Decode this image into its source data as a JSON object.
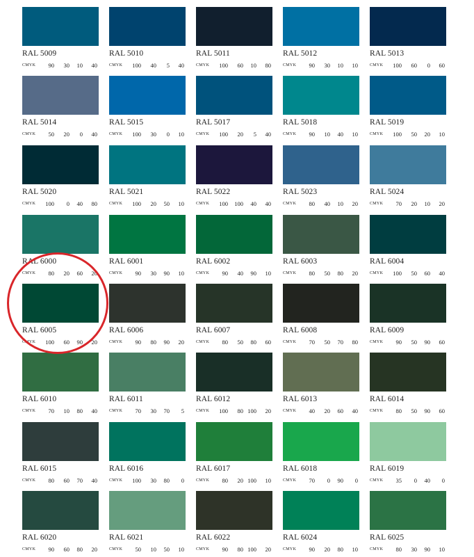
{
  "cmyk_label": "CMYK",
  "highlight_color": "#d9262a",
  "highlighted": "RAL 6005",
  "rows": [
    [
      {
        "name": "RAL 5009",
        "hex": "#005B7D",
        "c": "90",
        "m": "30",
        "y": "10",
        "k": "40"
      },
      {
        "name": "RAL 5010",
        "hex": "#00436E",
        "c": "100",
        "m": "40",
        "y": "5",
        "k": "40"
      },
      {
        "name": "RAL 5011",
        "hex": "#111F2E",
        "c": "100",
        "m": "60",
        "y": "10",
        "k": "80"
      },
      {
        "name": "RAL 5012",
        "hex": "#0070A3",
        "c": "90",
        "m": "30",
        "y": "10",
        "k": "10"
      },
      {
        "name": "RAL 5013",
        "hex": "#03294E",
        "c": "100",
        "m": "60",
        "y": "0",
        "k": "60"
      }
    ],
    [
      {
        "name": "RAL 5014",
        "hex": "#566B88",
        "c": "50",
        "m": "20",
        "y": "0",
        "k": "40"
      },
      {
        "name": "RAL 5015",
        "hex": "#0067AA",
        "c": "100",
        "m": "30",
        "y": "0",
        "k": "10"
      },
      {
        "name": "RAL 5017",
        "hex": "#00527C",
        "c": "100",
        "m": "20",
        "y": "5",
        "k": "40"
      },
      {
        "name": "RAL 5018",
        "hex": "#00878D",
        "c": "90",
        "m": "10",
        "y": "40",
        "k": "10"
      },
      {
        "name": "RAL 5019",
        "hex": "#005A88",
        "c": "100",
        "m": "50",
        "y": "20",
        "k": "10"
      }
    ],
    [
      {
        "name": "RAL 5020",
        "hex": "#002B35",
        "c": "100",
        "m": "0",
        "y": "40",
        "k": "80"
      },
      {
        "name": "RAL 5021",
        "hex": "#007480",
        "c": "100",
        "m": "20",
        "y": "50",
        "k": "10"
      },
      {
        "name": "RAL 5022",
        "hex": "#1C173C",
        "c": "100",
        "m": "100",
        "y": "40",
        "k": "40"
      },
      {
        "name": "RAL 5023",
        "hex": "#2F628C",
        "c": "80",
        "m": "40",
        "y": "10",
        "k": "20"
      },
      {
        "name": "RAL 5024",
        "hex": "#3F7B9C",
        "c": "70",
        "m": "20",
        "y": "10",
        "k": "20"
      }
    ],
    [
      {
        "name": "RAL 6000",
        "hex": "#1A7566",
        "c": "80",
        "m": "20",
        "y": "60",
        "k": "20"
      },
      {
        "name": "RAL 6001",
        "hex": "#007541",
        "c": "90",
        "m": "30",
        "y": "90",
        "k": "10"
      },
      {
        "name": "RAL 6002",
        "hex": "#036739",
        "c": "90",
        "m": "40",
        "y": "90",
        "k": "10"
      },
      {
        "name": "RAL 6003",
        "hex": "#3A5745",
        "c": "80",
        "m": "50",
        "y": "80",
        "k": "20"
      },
      {
        "name": "RAL 6004",
        "hex": "#003D40",
        "c": "100",
        "m": "50",
        "y": "60",
        "k": "40"
      }
    ],
    [
      {
        "name": "RAL 6005",
        "hex": "#004834",
        "c": "100",
        "m": "60",
        "y": "90",
        "k": "20"
      },
      {
        "name": "RAL 6006",
        "hex": "#2D332D",
        "c": "90",
        "m": "80",
        "y": "90",
        "k": "20"
      },
      {
        "name": "RAL 6007",
        "hex": "#263428",
        "c": "80",
        "m": "50",
        "y": "80",
        "k": "60"
      },
      {
        "name": "RAL 6008",
        "hex": "#22241F",
        "c": "70",
        "m": "50",
        "y": "70",
        "k": "80"
      },
      {
        "name": "RAL 6009",
        "hex": "#1A3326",
        "c": "90",
        "m": "50",
        "y": "90",
        "k": "60"
      }
    ],
    [
      {
        "name": "RAL 6010",
        "hex": "#306D42",
        "c": "70",
        "m": "10",
        "y": "80",
        "k": "40"
      },
      {
        "name": "RAL 6011",
        "hex": "#497F64",
        "c": "70",
        "m": "30",
        "y": "70",
        "k": "5"
      },
      {
        "name": "RAL 6012",
        "hex": "#192F27",
        "c": "100",
        "m": "80",
        "y": "100",
        "k": "20"
      },
      {
        "name": "RAL 6013",
        "hex": "#616E52",
        "c": "40",
        "m": "20",
        "y": "60",
        "k": "40"
      },
      {
        "name": "RAL 6014",
        "hex": "#263423",
        "c": "80",
        "m": "50",
        "y": "90",
        "k": "60"
      }
    ],
    [
      {
        "name": "RAL 6015",
        "hex": "#2E3D3C",
        "c": "80",
        "m": "60",
        "y": "70",
        "k": "40"
      },
      {
        "name": "RAL 6016",
        "hex": "#00735E",
        "c": "100",
        "m": "30",
        "y": "80",
        "k": "0"
      },
      {
        "name": "RAL 6017",
        "hex": "#1F7F3A",
        "c": "80",
        "m": "20",
        "y": "100",
        "k": "10"
      },
      {
        "name": "RAL 6018",
        "hex": "#19A74C",
        "c": "70",
        "m": "0",
        "y": "90",
        "k": "0"
      },
      {
        "name": "RAL 6019",
        "hex": "#8EC99F",
        "c": "35",
        "m": "0",
        "y": "40",
        "k": "0"
      }
    ],
    [
      {
        "name": "RAL 6020",
        "hex": "#254A40",
        "c": "90",
        "m": "60",
        "y": "80",
        "k": "20"
      },
      {
        "name": "RAL 6021",
        "hex": "#659D7E",
        "c": "50",
        "m": "10",
        "y": "50",
        "k": "10"
      },
      {
        "name": "RAL 6022",
        "hex": "#2E3328",
        "c": "90",
        "m": "80",
        "y": "100",
        "k": "20"
      },
      {
        "name": "RAL 6024",
        "hex": "#008157",
        "c": "90",
        "m": "20",
        "y": "80",
        "k": "10"
      },
      {
        "name": "RAL 6025",
        "hex": "#2B7345",
        "c": "80",
        "m": "30",
        "y": "90",
        "k": "10"
      }
    ]
  ]
}
